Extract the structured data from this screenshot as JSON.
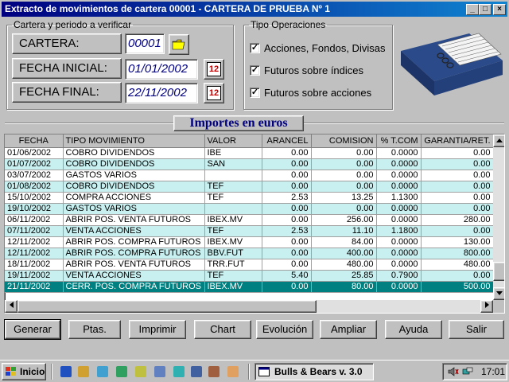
{
  "window": {
    "title": "Extracto de movimientos de cartera 00001 - CARTERA DE PRUEBA Nº 1",
    "minimize": "_",
    "maximize": "□",
    "close": "×"
  },
  "filters": {
    "legend": "Cartera y periodo a verificar",
    "cartera_label": "CARTERA:",
    "cartera_value": "00001",
    "fecha_inicial_label": "FECHA INICIAL:",
    "fecha_inicial_value": "01/01/2002",
    "fecha_final_label": "FECHA FINAL:",
    "fecha_final_value": "22/11/2002",
    "calendar_glyph": "12"
  },
  "operations": {
    "legend": "Tipo Operaciones",
    "check_glyph": "✓",
    "items": [
      {
        "label": "Acciones, Fondos, Divisas",
        "checked": true
      },
      {
        "label": "Futuros sobre índices",
        "checked": true
      },
      {
        "label": "Futuros sobre acciones",
        "checked": true
      }
    ]
  },
  "section_title": "Importes en euros",
  "table": {
    "columns": [
      "FECHA",
      "TIPO MOVIMIENTO",
      "VALOR",
      "ARANCEL",
      "COMISION",
      "% T.COM",
      "GARANTIA/RET."
    ],
    "rows": [
      [
        "01/06/2002",
        "COBRO DIVIDENDOS",
        "IBE",
        "0.00",
        "0.00",
        "0.0000",
        "0.00"
      ],
      [
        "01/07/2002",
        "COBRO DIVIDENDOS",
        "SAN",
        "0.00",
        "0.00",
        "0.0000",
        "0.00"
      ],
      [
        "03/07/2002",
        "GASTOS VARIOS",
        "",
        "0.00",
        "0.00",
        "0.0000",
        "0.00"
      ],
      [
        "01/08/2002",
        "COBRO DIVIDENDOS",
        "TEF",
        "0.00",
        "0.00",
        "0.0000",
        "0.00"
      ],
      [
        "15/10/2002",
        "COMPRA ACCIONES",
        "TEF",
        "2.53",
        "13.25",
        "1.1300",
        "0.00"
      ],
      [
        "19/10/2002",
        "GASTOS VARIOS",
        "",
        "0.00",
        "0.00",
        "0.0000",
        "0.00"
      ],
      [
        "06/11/2002",
        "ABRIR POS. VENTA FUTUROS",
        "IBEX.MV",
        "0.00",
        "256.00",
        "0.0000",
        "280.00"
      ],
      [
        "07/11/2002",
        "VENTA ACCIONES",
        "TEF",
        "2.53",
        "11.10",
        "1.1800",
        "0.00"
      ],
      [
        "12/11/2002",
        "ABRIR POS. COMPRA FUTUROS",
        "IBEX.MV",
        "0.00",
        "84.00",
        "0.0000",
        "130.00"
      ],
      [
        "12/11/2002",
        "ABRIR POS. COMPRA FUTUROS",
        "BBV.FUT",
        "0.00",
        "400.00",
        "0.0000",
        "800.00"
      ],
      [
        "18/11/2002",
        "ABRIR POS. VENTA FUTUROS",
        "TRR.FUT",
        "0.00",
        "480.00",
        "0.0000",
        "480.00"
      ],
      [
        "19/11/2002",
        "VENTA ACCIONES",
        "TEF",
        "5.40",
        "25.85",
        "0.7900",
        "0.00"
      ],
      [
        "21/11/2002",
        "CERR. POS. COMPRA FUTUROS",
        "IBEX.MV",
        "0.00",
        "80.00",
        "0.0000",
        "500.00"
      ]
    ],
    "selected_row": 12
  },
  "buttons": [
    "Generar",
    "Ptas.",
    "Imprimir",
    "Chart",
    "Evolución",
    "Ampliar",
    "Ayuda",
    "Salir"
  ],
  "taskbar": {
    "start_label": "Inicio",
    "task_label": "Bulls & Bears v. 3.0",
    "clock": "17:01"
  }
}
